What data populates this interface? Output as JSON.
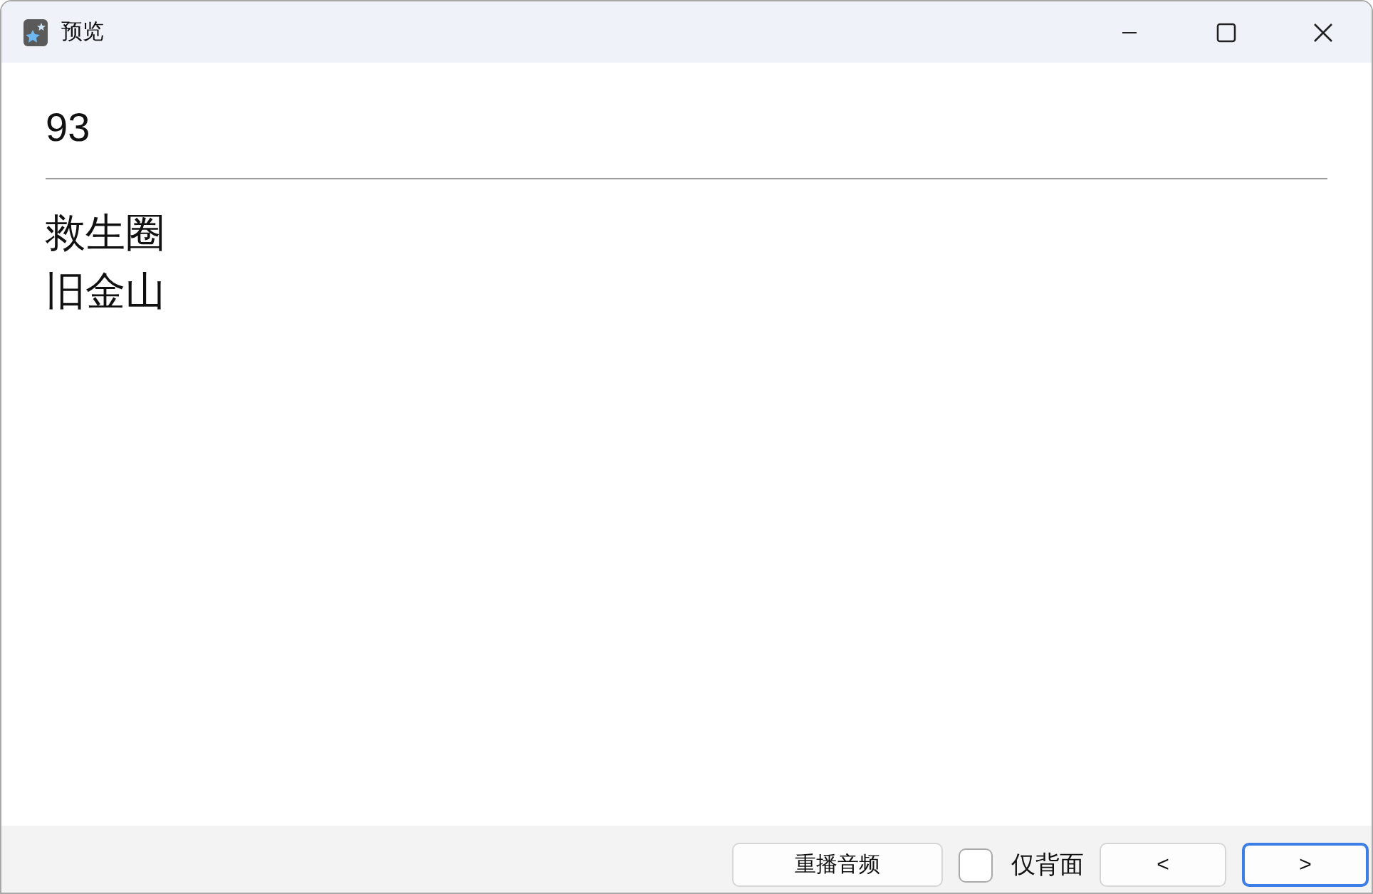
{
  "window": {
    "title": "预览"
  },
  "card": {
    "front": "93",
    "back_lines": [
      "救生圈",
      "旧金山"
    ]
  },
  "bottom_bar": {
    "replay_button": "重播音频",
    "back_only": {
      "label": "仅背面",
      "checked": false
    },
    "nav_buttons": [
      {
        "label": "<",
        "focused": false
      },
      {
        "label": ">",
        "focused": true
      }
    ]
  }
}
